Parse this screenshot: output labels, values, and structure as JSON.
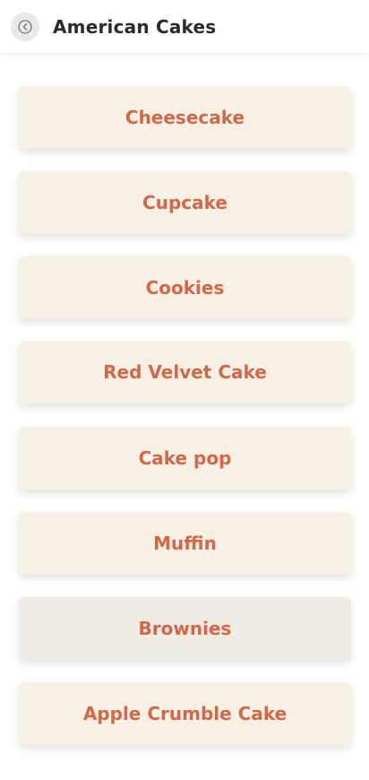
{
  "header": {
    "title": "American Cakes",
    "back_icon": "back-arrow-circle-icon"
  },
  "colors": {
    "card_background": "#f6f1e4",
    "card_pressed_background": "#f1ece3",
    "card_text": "#d2674a",
    "title_text": "#2b2b2b"
  },
  "cakes": [
    {
      "label": "Cheesecake"
    },
    {
      "label": "Cupcake"
    },
    {
      "label": "Cookies"
    },
    {
      "label": "Red Velvet Cake"
    },
    {
      "label": "Cake pop"
    },
    {
      "label": "Muffin"
    },
    {
      "label": "Brownies"
    },
    {
      "label": "Apple Crumble Cake"
    }
  ]
}
